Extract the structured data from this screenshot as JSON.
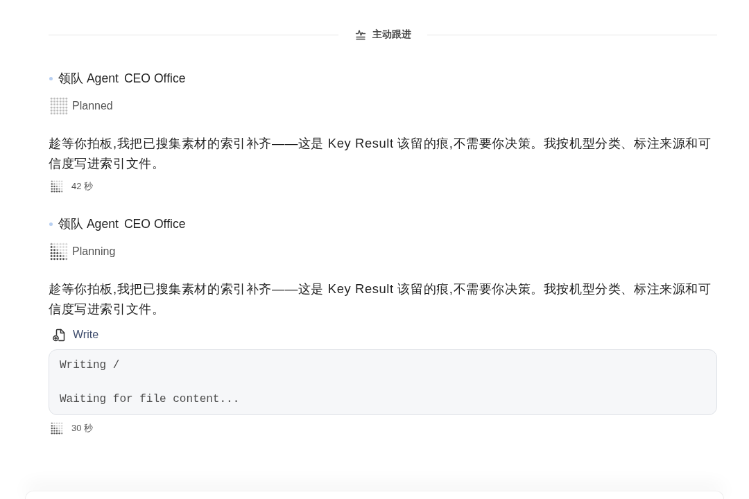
{
  "divider": {
    "label": "主动跟进"
  },
  "messages": [
    {
      "agent": {
        "role": "领队 Agent",
        "name": "CEO Office"
      },
      "status": {
        "kind": "planned",
        "label": "Planned"
      },
      "body": "趁等你拍板,我把已搜集素材的索引补齐——这是 Key Result 该留的痕,不需要你决策。我按机型分类、标注来源和可信度写进索引文件。",
      "duration": "42 秒"
    },
    {
      "agent": {
        "role": "领队 Agent",
        "name": "CEO Office"
      },
      "status": {
        "kind": "planning",
        "label": "Planning"
      },
      "body": "趁等你拍板,我把已搜集素材的索引补齐——这是 Key Result 该留的痕,不需要你决策。我按机型分类、标注来源和可信度写进索引文件。",
      "tool": {
        "kind": "write",
        "label": "Write",
        "output": "Writing /\n\nWaiting for file content..."
      },
      "duration": "30 秒"
    }
  ]
}
